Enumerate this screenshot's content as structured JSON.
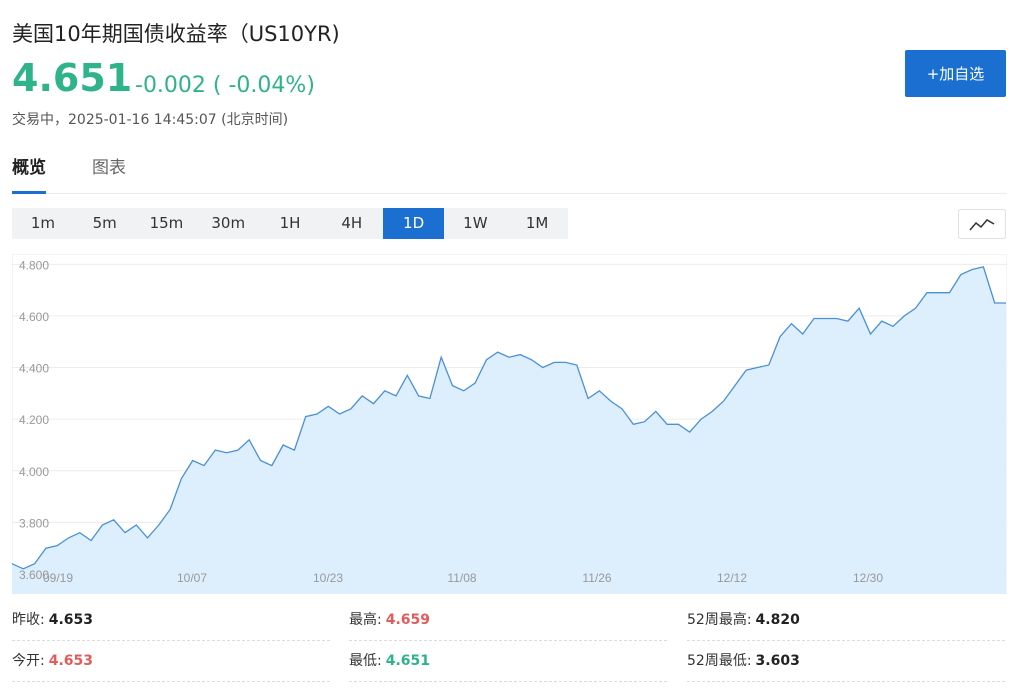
{
  "header": {
    "title": "美国10年期国债收益率（US10YR)",
    "price": "4.651",
    "change": "-0.002 ( -0.04%)",
    "status": "交易中，2025-01-16 14:45:07 (北京时间)",
    "add_button": "+加自选"
  },
  "tabs": [
    {
      "label": "概览",
      "active": true
    },
    {
      "label": "图表",
      "active": false
    }
  ],
  "periods": [
    "1m",
    "5m",
    "15m",
    "30m",
    "1H",
    "4H",
    "1D",
    "1W",
    "1M"
  ],
  "active_period": "1D",
  "chart_type_icon": "line-chart-icon",
  "stats": {
    "prev_close": {
      "label": "昨收:",
      "value": "4.653"
    },
    "open": {
      "label": "今开:",
      "value": "4.653"
    },
    "high": {
      "label": "最高:",
      "value": "4.659"
    },
    "low": {
      "label": "最低:",
      "value": "4.651"
    },
    "high52": {
      "label": "52周最高:",
      "value": "4.820"
    },
    "low52": {
      "label": "52周最低:",
      "value": "3.603"
    }
  },
  "colors": {
    "up": "#2fb38a",
    "down": "#e35b5b",
    "accent": "#1a6fd1",
    "line": "#4a90d9",
    "fill": "#ddeefc"
  },
  "chart_data": {
    "type": "area",
    "ylim": [
      3.6,
      4.84
    ],
    "yticks": [
      "3.600",
      "3.800",
      "4.000",
      "4.200",
      "4.400",
      "4.600",
      "4.800"
    ],
    "xticks": [
      "09/19",
      "10/07",
      "10/23",
      "11/08",
      "11/26",
      "12/12",
      "12/30"
    ],
    "grid": true,
    "values": [
      3.64,
      3.62,
      3.64,
      3.7,
      3.71,
      3.74,
      3.76,
      3.73,
      3.79,
      3.81,
      3.76,
      3.79,
      3.74,
      3.79,
      3.85,
      3.97,
      4.04,
      4.02,
      4.08,
      4.07,
      4.08,
      4.12,
      4.04,
      4.02,
      4.1,
      4.08,
      4.21,
      4.22,
      4.25,
      4.22,
      4.24,
      4.29,
      4.26,
      4.31,
      4.29,
      4.37,
      4.29,
      4.28,
      4.44,
      4.33,
      4.31,
      4.34,
      4.43,
      4.46,
      4.44,
      4.45,
      4.43,
      4.4,
      4.42,
      4.42,
      4.41,
      4.28,
      4.31,
      4.27,
      4.24,
      4.18,
      4.19,
      4.23,
      4.18,
      4.18,
      4.15,
      4.2,
      4.23,
      4.27,
      4.33,
      4.39,
      4.4,
      4.41,
      4.52,
      4.57,
      4.53,
      4.59,
      4.59,
      4.59,
      4.58,
      4.63,
      4.53,
      4.58,
      4.56,
      4.6,
      4.63,
      4.69,
      4.69,
      4.69,
      4.76,
      4.78,
      4.79,
      4.65,
      4.65
    ]
  }
}
